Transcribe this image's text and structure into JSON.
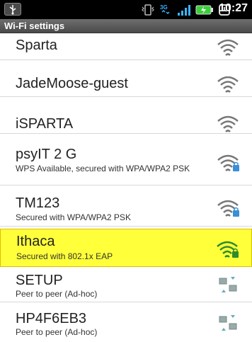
{
  "status_bar": {
    "time": "10:27",
    "network_type": "3G"
  },
  "header": {
    "title": "Wi-Fi settings"
  },
  "networks": [
    {
      "ssid": "Sparta",
      "detail": "",
      "signal_icon": "wifi-signal-icon",
      "secured": false
    },
    {
      "ssid": "JadeMoose-guest",
      "detail": "",
      "signal_icon": "wifi-signal-icon",
      "secured": false
    },
    {
      "ssid": "iSPARTA",
      "detail": "",
      "signal_icon": "wifi-signal-icon",
      "secured": false
    },
    {
      "ssid": "psyIT 2 G",
      "detail": "WPS Available, secured with WPA/WPA2 PSK",
      "signal_icon": "wifi-lock-icon",
      "secured": true
    },
    {
      "ssid": "TM123",
      "detail": "Secured with WPA/WPA2 PSK",
      "signal_icon": "wifi-lock-icon",
      "secured": true
    },
    {
      "ssid": "Ithaca",
      "detail": "Secured with 802.1x EAP",
      "signal_icon": "wifi-lock-icon",
      "secured": true,
      "selected": true
    },
    {
      "ssid": "SETUP",
      "detail": "Peer to peer (Ad-hoc)",
      "signal_icon": "adhoc-icon",
      "secured": false
    },
    {
      "ssid": "HP4F6EB3",
      "detail": "Peer to peer (Ad-hoc)",
      "signal_icon": "adhoc-icon",
      "secured": false
    }
  ],
  "colors": {
    "selected_bg": "#ffff3a",
    "selected_icon": "#2e8b2e",
    "status_bg": "#000000"
  }
}
